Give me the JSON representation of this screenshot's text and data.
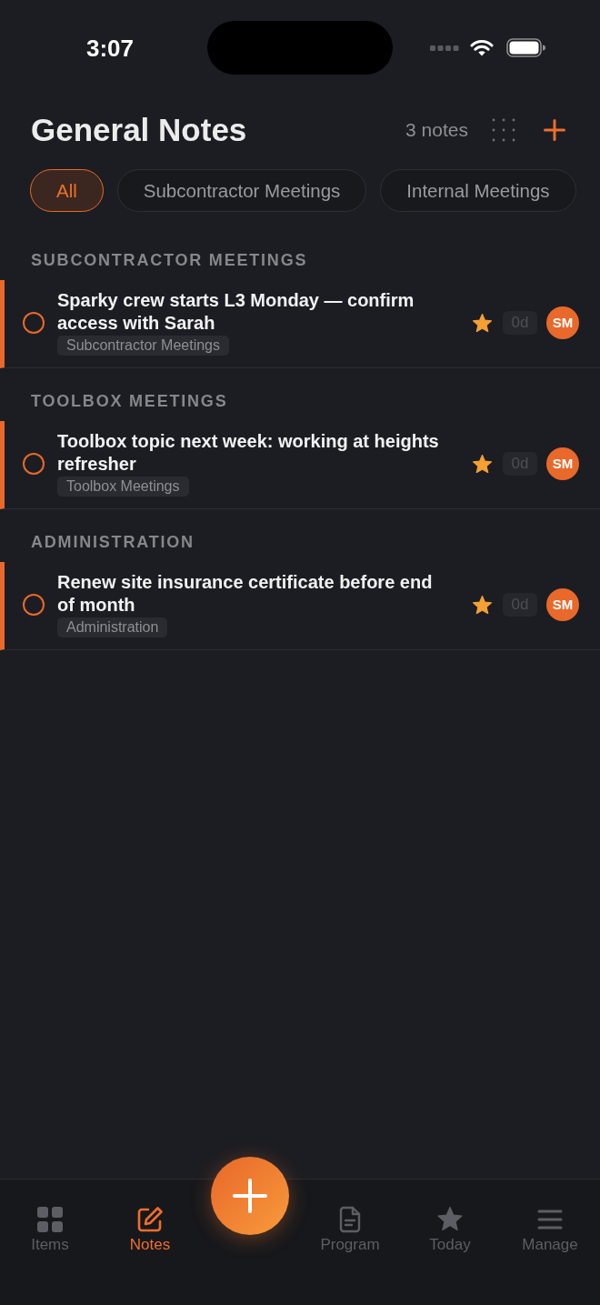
{
  "status_bar": {
    "time": "3:07"
  },
  "header": {
    "title": "General Notes",
    "count": "3 notes"
  },
  "filters": [
    {
      "label": "All",
      "selected": true
    },
    {
      "label": "Subcontractor Meetings",
      "selected": false
    },
    {
      "label": "Internal Meetings",
      "selected": false
    }
  ],
  "sections": [
    {
      "heading": "SUBCONTRACTOR MEETINGS",
      "notes": [
        {
          "title": "Sparky crew starts L3 Monday — confirm access with Sarah",
          "tag": "Subcontractor Meetings",
          "done": false,
          "starred": true,
          "age": "0d",
          "assignee": "SM"
        }
      ]
    },
    {
      "heading": "TOOLBOX MEETINGS",
      "notes": [
        {
          "title": "Toolbox topic next week: working at heights refresher",
          "tag": "Toolbox Meetings",
          "done": false,
          "starred": true,
          "age": "0d",
          "assignee": "SM"
        }
      ]
    },
    {
      "heading": "ADMINISTRATION",
      "notes": [
        {
          "title": "Renew site insurance certificate before end of month",
          "tag": "Administration",
          "done": false,
          "starred": true,
          "age": "0d",
          "assignee": "SM"
        }
      ]
    }
  ],
  "tab_bar": [
    {
      "kind": "grid",
      "label": "Items",
      "selected": false
    },
    {
      "kind": "notes",
      "label": "Notes",
      "selected": true
    },
    {
      "kind": "add"
    },
    {
      "kind": "program",
      "label": "Program",
      "selected": false
    },
    {
      "kind": "today",
      "label": "Today",
      "selected": false
    },
    {
      "kind": "manage",
      "label": "Manage",
      "selected": false
    }
  ]
}
